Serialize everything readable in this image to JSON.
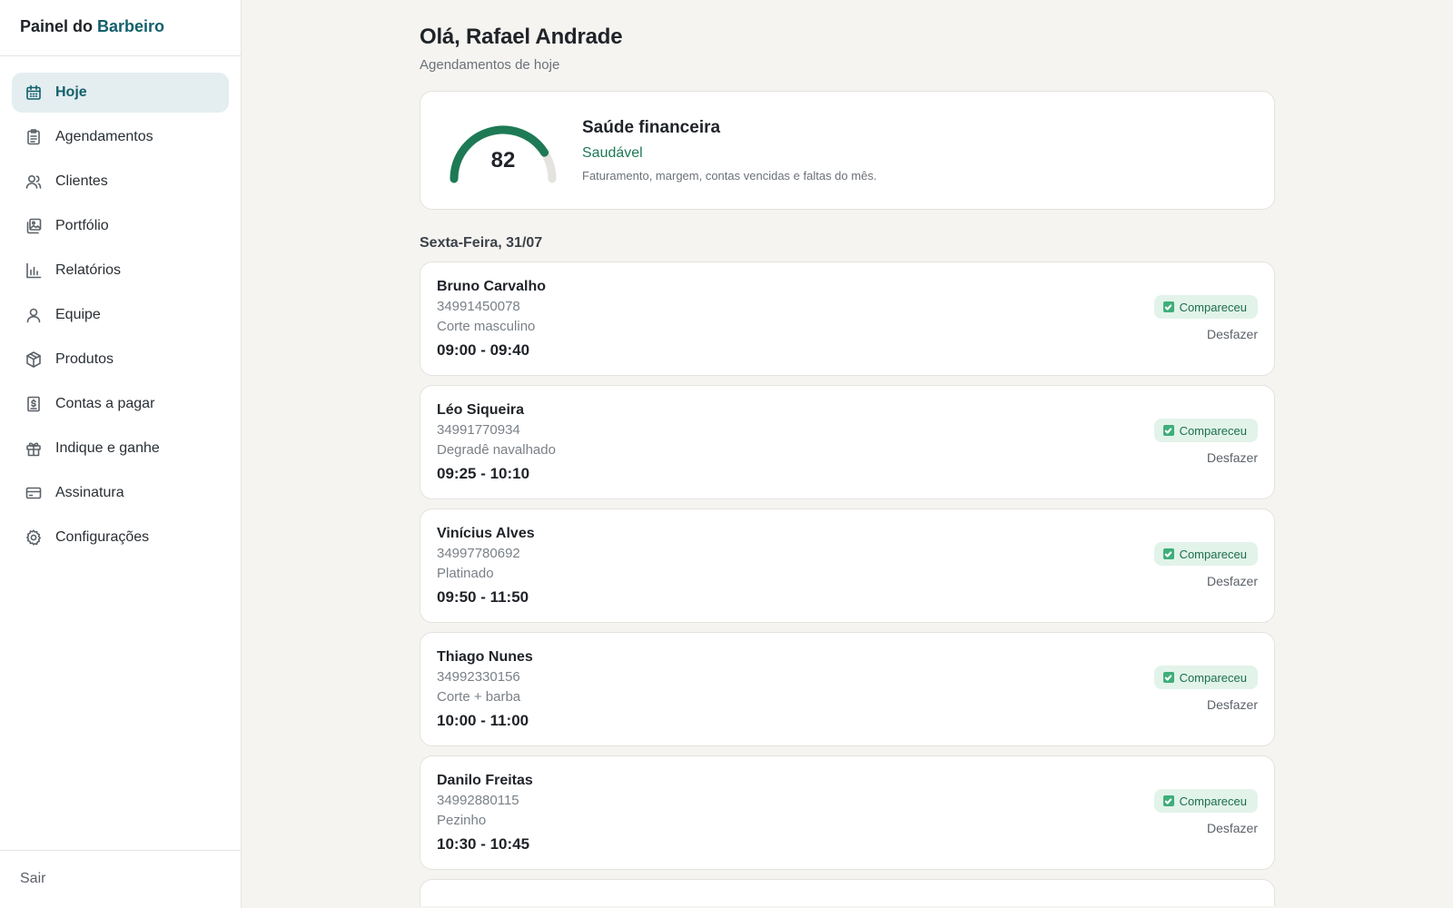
{
  "brand": {
    "prefix": "Painel do",
    "accent": "Barbeiro"
  },
  "sidebar": {
    "items": [
      {
        "label": "Hoje",
        "icon": "calendar-icon",
        "active": true
      },
      {
        "label": "Agendamentos",
        "icon": "clipboard-icon"
      },
      {
        "label": "Clientes",
        "icon": "users-icon"
      },
      {
        "label": "Portfólio",
        "icon": "images-icon"
      },
      {
        "label": "Relatórios",
        "icon": "bar-chart-icon"
      },
      {
        "label": "Equipe",
        "icon": "user-icon"
      },
      {
        "label": "Produtos",
        "icon": "package-icon"
      },
      {
        "label": "Contas a pagar",
        "icon": "receipt-icon"
      },
      {
        "label": "Indique e ganhe",
        "icon": "gift-icon"
      },
      {
        "label": "Assinatura",
        "icon": "credit-card-icon"
      },
      {
        "label": "Configurações",
        "icon": "gear-icon"
      }
    ],
    "footer": "Sair"
  },
  "header": {
    "greeting": "Olá, Rafael Andrade",
    "subtitle": "Agendamentos de hoje"
  },
  "health": {
    "score": "82",
    "score_fraction": 0.82,
    "title": "Saúde financeira",
    "status": "Saudável",
    "description": "Faturamento, margem, contas vencidas e faltas do mês.",
    "color": "#1d7a55"
  },
  "day_label": "Sexta-Feira, 31/07",
  "appointments": [
    {
      "name": "Bruno Carvalho",
      "phone": "34991450078",
      "service": "Corte masculino",
      "time": "09:00 - 09:40",
      "status": "Compareceu",
      "undo": "Desfazer"
    },
    {
      "name": "Léo Siqueira",
      "phone": "34991770934",
      "service": "Degradê navalhado",
      "time": "09:25 - 10:10",
      "status": "Compareceu",
      "undo": "Desfazer"
    },
    {
      "name": "Vinícius Alves",
      "phone": "34997780692",
      "service": "Platinado",
      "time": "09:50 - 11:50",
      "status": "Compareceu",
      "undo": "Desfazer"
    },
    {
      "name": "Thiago Nunes",
      "phone": "34992330156",
      "service": "Corte + barba",
      "time": "10:00 - 11:00",
      "status": "Compareceu",
      "undo": "Desfazer"
    },
    {
      "name": "Danilo Freitas",
      "phone": "34992880115",
      "service": "Pezinho",
      "time": "10:30 - 10:45",
      "status": "Compareceu",
      "undo": "Desfazer"
    }
  ]
}
